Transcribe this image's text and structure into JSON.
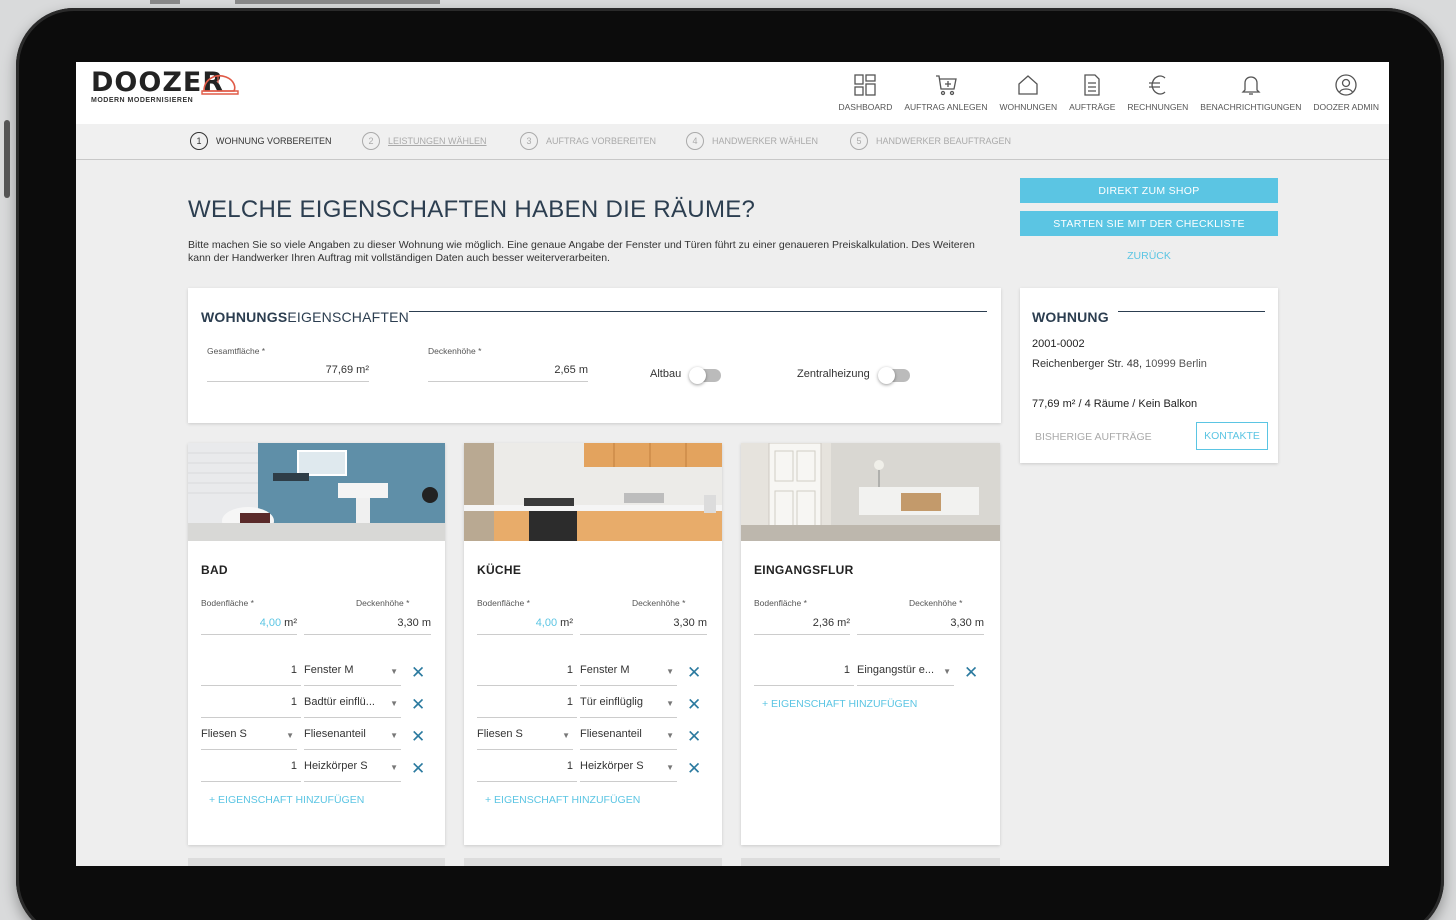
{
  "brand": {
    "name": "DOOZER",
    "tagline": "MODERN MODERNISIEREN"
  },
  "nav": [
    {
      "label": "DASHBOARD",
      "icon": "dashboard-icon"
    },
    {
      "label": "AUFTRAG ANLEGEN",
      "icon": "cart-plus-icon"
    },
    {
      "label": "WOHNUNGEN",
      "icon": "house-icon"
    },
    {
      "label": "AUFTRÄGE",
      "icon": "document-icon"
    },
    {
      "label": "RECHNUNGEN",
      "icon": "euro-icon"
    },
    {
      "label": "BENACHRICHTIGUNGEN",
      "icon": "bell-icon"
    },
    {
      "label": "DOOZER ADMIN",
      "icon": "user-icon"
    }
  ],
  "steps": [
    {
      "num": "1",
      "label": "WOHNUNG VORBEREITEN"
    },
    {
      "num": "2",
      "label": "LEISTUNGEN WÄHLEN"
    },
    {
      "num": "3",
      "label": "AUFTRAG VORBEREITEN"
    },
    {
      "num": "4",
      "label": "HANDWERKER WÄHLEN"
    },
    {
      "num": "5",
      "label": "HANDWERKER BEAUFTRAGEN"
    }
  ],
  "page": {
    "title": "WELCHE EIGENSCHAFTEN HABEN DIE RÄUME?",
    "intro": "Bitte machen Sie so viele Angaben zu dieser Wohnung wie möglich. Eine genaue Angabe der Fenster und Türen führt zu einer genaueren Preiskalkulation. Des Weiteren kann der Handwerker Ihren Auftrag mit vollständigen Daten auch besser weiterverarbeiten."
  },
  "actions": {
    "shop": "DIREKT ZUM SHOP",
    "checklist": "STARTEN SIE MIT DER CHECKLISTE",
    "back": "ZURÜCK"
  },
  "properties": {
    "title_bold": "WOHNUNGS",
    "title_rest": "EIGENSCHAFTEN",
    "area_label": "Gesamtfläche *",
    "area_value": "77,69 m²",
    "height_label": "Deckenhöhe *",
    "height_value": "2,65 m",
    "altbau": "Altbau",
    "zentralheizung": "Zentralheizung"
  },
  "apartment": {
    "title": "WOHNUNG",
    "number": "2001-0002",
    "street": "Reichenberger Str. 48, ",
    "city": "10999 Berlin",
    "summary": "77,69 m² / 4 Räume / Kein Balkon",
    "previous_orders": "BISHERIGE AUFTRÄGE",
    "contacts": "KONTAKTE"
  },
  "rooms": [
    {
      "name": "BAD",
      "floor_label": "Bodenfläche *",
      "floor_value": "4,00",
      "floor_unit": " m²",
      "height_label": "Deckenhöhe *",
      "height_value": "3,30 m",
      "rows": [
        {
          "qty": "1",
          "item": "Fenster M"
        },
        {
          "qty": "1",
          "item": "Badtür einflü..."
        },
        {
          "left": "Fliesen S",
          "item": "Fliesenanteil"
        },
        {
          "qty": "1",
          "item": "Heizkörper S"
        }
      ],
      "add": "+ EIGENSCHAFT HINZUFÜGEN"
    },
    {
      "name": "KÜCHE",
      "floor_label": "Bodenfläche *",
      "floor_value": "4,00",
      "floor_unit": " m²",
      "height_label": "Deckenhöhe *",
      "height_value": "3,30 m",
      "rows": [
        {
          "qty": "1",
          "item": "Fenster M"
        },
        {
          "qty": "1",
          "item": "Tür einflüglig"
        },
        {
          "left": "Fliesen S",
          "item": "Fliesenanteil"
        },
        {
          "qty": "1",
          "item": "Heizkörper S"
        }
      ],
      "add": "+ EIGENSCHAFT HINZUFÜGEN"
    },
    {
      "name": "EINGANGSFLUR",
      "floor_label": "Bodenfläche *",
      "floor_value": "2,36 m²",
      "height_label": "Deckenhöhe *",
      "height_value": "3,30 m",
      "rows": [
        {
          "qty": "1",
          "item": "Eingangstür e..."
        }
      ],
      "add": "+ EIGENSCHAFT HINZUFÜGEN"
    }
  ],
  "colors": {
    "accent": "#5bc5e3",
    "dark": "#2c3e50",
    "x": "#2b7a9f"
  }
}
